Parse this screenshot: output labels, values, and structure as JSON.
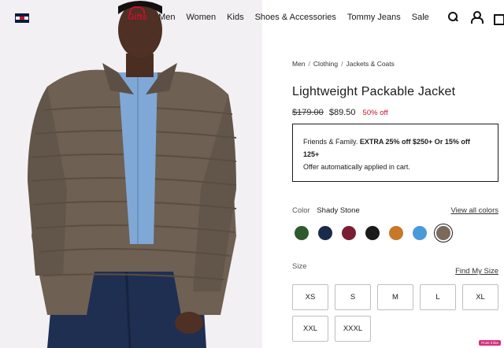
{
  "nav": {
    "links": [
      "Gifts",
      "Men",
      "Women",
      "Kids",
      "Shoes & Accessories",
      "Tommy Jeans",
      "Sale"
    ],
    "icons": [
      "search-icon",
      "user-icon",
      "bag-icon"
    ]
  },
  "breadcrumb": [
    "Men",
    "Clothing",
    "Jackets & Coats"
  ],
  "product": {
    "title": "Lightweight Packable Jacket",
    "price_old": "$179.00",
    "price_new": "$89.50",
    "discount": "50% off"
  },
  "promo": {
    "lead": "Friends & Family. ",
    "bold": "EXTRA 25% off $250+ Or 15% off 125+",
    "note": "Offer automatically applied in cart."
  },
  "color": {
    "label": "Color",
    "selected_name": "Shady Stone",
    "view_all": "View all colors",
    "swatches": [
      "#2e5a2c",
      "#1c2a4a",
      "#7a1f33",
      "#1a1a1a",
      "#c7782a",
      "#4b9ad8",
      "#7b6a5c"
    ],
    "selected_index": 6
  },
  "size": {
    "label": "Size",
    "guide": "Find My Size",
    "options": [
      "XS",
      "S",
      "M",
      "L",
      "XL",
      "XXL",
      "XXXL"
    ]
  },
  "badge": "Point it like"
}
